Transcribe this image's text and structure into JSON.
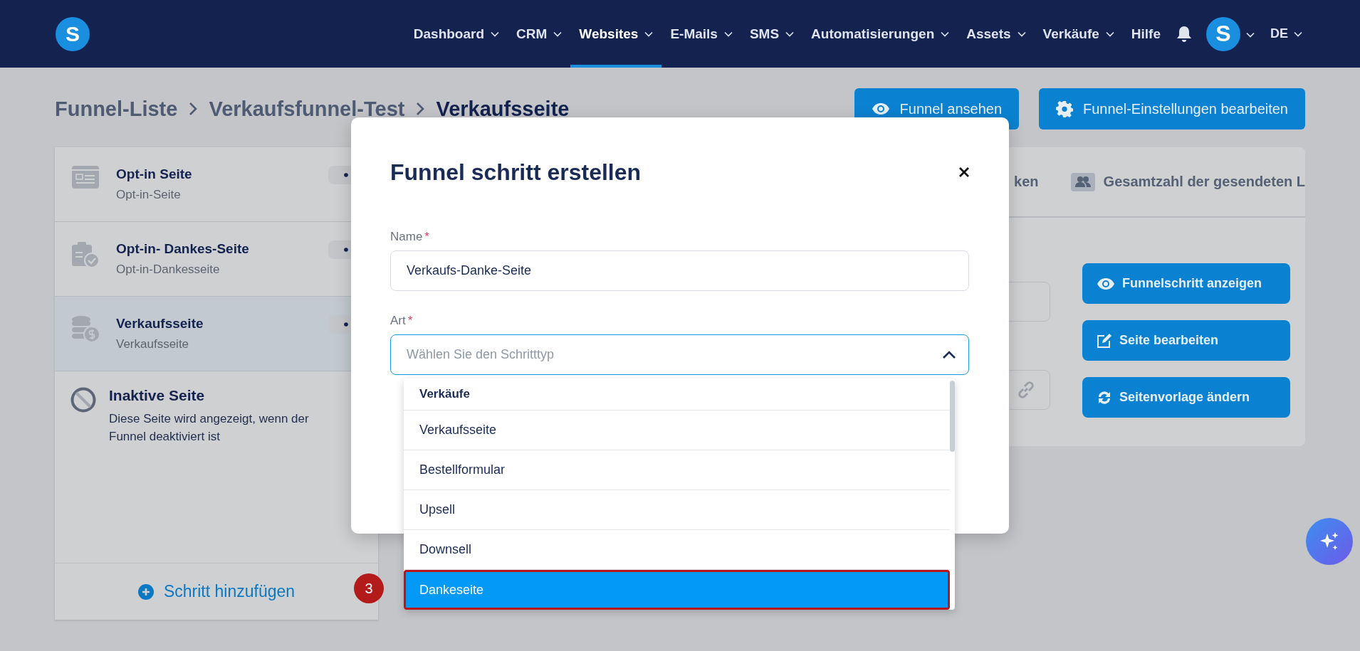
{
  "nav": {
    "logo": "S",
    "items": [
      {
        "label": "Dashboard",
        "dropdown": true,
        "selected": false
      },
      {
        "label": "CRM",
        "dropdown": true,
        "selected": false
      },
      {
        "label": "Websites",
        "dropdown": true,
        "selected": true
      },
      {
        "label": "E-Mails",
        "dropdown": true,
        "selected": false
      },
      {
        "label": "SMS",
        "dropdown": true,
        "selected": false
      },
      {
        "label": "Automatisierungen",
        "dropdown": true,
        "selected": false
      },
      {
        "label": "Assets",
        "dropdown": true,
        "selected": false
      },
      {
        "label": "Verkäufe",
        "dropdown": true,
        "selected": false
      },
      {
        "label": "Hilfe",
        "dropdown": false,
        "selected": false
      }
    ],
    "avatar": "S",
    "language": "DE"
  },
  "breadcrumb": [
    "Funnel-Liste",
    "Verkaufsfunnel-Test",
    "Verkaufsseite"
  ],
  "header_buttons": [
    {
      "label": "Funnel ansehen",
      "kind": "eye"
    },
    {
      "label": "Funnel-Einstellungen bearbeiten",
      "kind": "gear"
    }
  ],
  "steps": [
    {
      "title": "Opt-in Seite",
      "subtitle": "Opt-in-Seite",
      "kind": "form",
      "selected": false
    },
    {
      "title": "Opt-in- Dankes-Seite",
      "subtitle": "Opt-in-Dankesseite",
      "kind": "clipboard",
      "selected": false
    },
    {
      "title": "Verkaufsseite",
      "subtitle": "Verkaufsseite",
      "kind": "coins",
      "selected": true
    }
  ],
  "inactive_page": {
    "title": "Inaktive Seite",
    "description": "Diese Seite wird angezeigt, wenn der Funnel deaktiviert ist"
  },
  "add_step": "Schritt hinzufügen",
  "stats_tabs": [
    {
      "label": "ken",
      "kind": "text"
    },
    {
      "label": "Gesamtzahl der gesendeten L",
      "kind": "people"
    }
  ],
  "step_fields": [
    {
      "kind": "plain"
    },
    {
      "kind": "link"
    }
  ],
  "step_actions": [
    {
      "label": "Funnelschritt anzeigen",
      "kind": "eye"
    },
    {
      "label": "Seite bearbeiten",
      "kind": "edit"
    },
    {
      "label": "Seitenvorlage ändern",
      "kind": "refresh"
    }
  ],
  "modal": {
    "title": "Funnel schritt erstellen",
    "fields": [
      {
        "label": "Name",
        "required_mark": "*",
        "kind": "text",
        "value": "Verkaufs-Danke-Seite"
      },
      {
        "label": "Art",
        "required_mark": "*",
        "kind": "select",
        "placeholder": "Wählen Sie den Schritttyp",
        "expanded": true
      }
    ],
    "dropdown": {
      "group": "Verkäufe",
      "options": [
        {
          "label": "Verkaufsseite",
          "selected": false
        },
        {
          "label": "Bestellformular",
          "selected": false
        },
        {
          "label": "Upsell",
          "selected": false
        },
        {
          "label": "Downsell",
          "selected": false
        },
        {
          "label": "Dankeseite",
          "selected": true
        }
      ]
    }
  },
  "callout": "3"
}
